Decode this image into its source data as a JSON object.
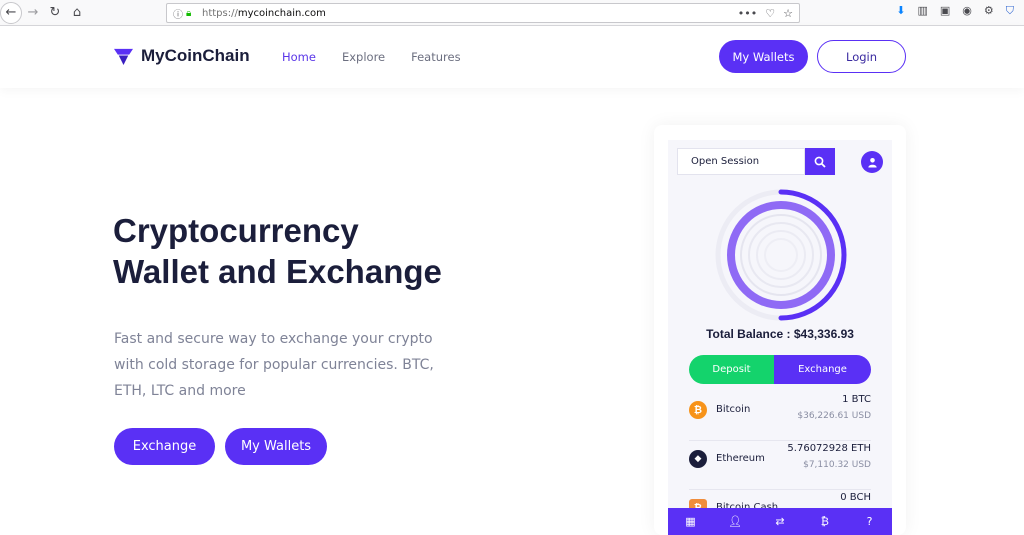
{
  "browser": {
    "url_protocol": "https://",
    "url_host": "mycoinchain.com",
    "icons": [
      "back-icon",
      "forward-icon",
      "reload-icon",
      "home-icon",
      "info-icon",
      "lock-icon",
      "more-icon",
      "pocket-icon",
      "bookmark-star-icon",
      "download-icon",
      "library-icon",
      "sidebar-icon",
      "account-icon",
      "extension-icon",
      "shield-icon"
    ]
  },
  "header": {
    "brand": "MyCoinChain",
    "nav": [
      {
        "label": "Home",
        "active": true
      },
      {
        "label": "Explore",
        "active": false
      },
      {
        "label": "Features",
        "active": false
      }
    ],
    "wallets_button": "My Wallets",
    "login_button": "Login"
  },
  "hero": {
    "title_line1": "Cryptocurrency",
    "title_line2": "Wallet and Exchange",
    "subtitle": "Fast and secure way to exchange your crypto with cold storage for popular currencies. BTC, ETH, LTC and more",
    "exchange_button": "Exchange",
    "wallets_button": "My Wallets"
  },
  "phone": {
    "session_placeholder": "Open Session",
    "balance_label": "Total Balance :",
    "balance_value": "$43,336.93",
    "deposit_button": "Deposit",
    "exchange_button": "Exchange",
    "coins": [
      {
        "name": "Bitcoin",
        "amount": "1 BTC",
        "usd": "$36,226.61 USD",
        "color": "#f7931a",
        "icon": "bitcoin-icon",
        "glyph": "₿"
      },
      {
        "name": "Ethereum",
        "amount": "5.76072928 ETH",
        "usd": "$7,110.32 USD",
        "color": "#1b1e3b",
        "icon": "ethereum-icon",
        "glyph": "◆"
      },
      {
        "name": "Bitcoin Cash",
        "amount": "0 BCH",
        "usd": "",
        "color": "#f08d3c",
        "icon": "bitcoin-cash-icon",
        "glyph": "₿"
      }
    ],
    "bottom_nav": [
      "dashboard-icon",
      "user-icon",
      "exchange-arrows-icon",
      "bitcoin-icon",
      "help-icon"
    ]
  },
  "colors": {
    "brand": "#5a30f5",
    "deposit": "#14d36c",
    "title": "#1b1e3b"
  }
}
